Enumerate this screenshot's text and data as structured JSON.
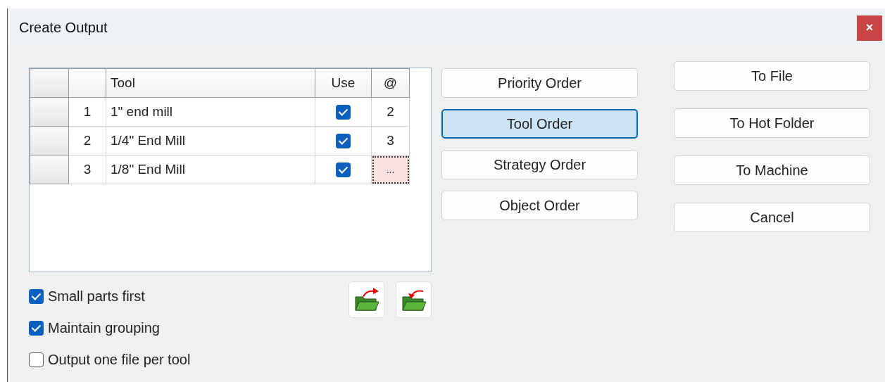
{
  "window": {
    "title": "Create Output",
    "close": "×"
  },
  "table": {
    "columns": [
      "Tool",
      "Use",
      "@"
    ],
    "rows": [
      {
        "number": "1",
        "tool": "1\" end mill",
        "use": true,
        "at": "2",
        "at_focused": false
      },
      {
        "number": "2",
        "tool": "1/4\" End Mill",
        "use": true,
        "at": "3",
        "at_focused": false
      },
      {
        "number": "3",
        "tool": "1/8\" End Mill",
        "use": true,
        "at": "...",
        "at_focused": true
      }
    ]
  },
  "order_buttons": [
    {
      "label": "Priority Order",
      "selected": false
    },
    {
      "label": "Tool Order",
      "selected": true
    },
    {
      "label": "Strategy Order",
      "selected": false
    },
    {
      "label": "Object Order",
      "selected": false
    }
  ],
  "output_buttons": [
    "To File",
    "To Hot Folder",
    "To Machine"
  ],
  "cancel": "Cancel",
  "options": [
    {
      "label": "Small parts first",
      "checked": true
    },
    {
      "label": "Maintain grouping",
      "checked": true
    },
    {
      "label": "Output one file per tool",
      "checked": false
    }
  ],
  "folder_buttons": [
    {
      "kind": "export"
    },
    {
      "kind": "import"
    }
  ]
}
